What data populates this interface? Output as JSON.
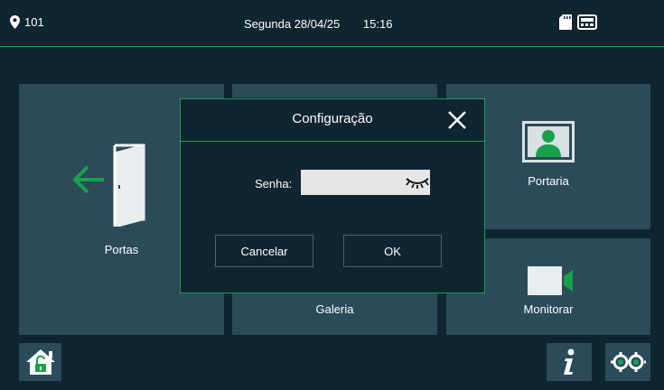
{
  "status_bar": {
    "location_icon": "location-pin-icon",
    "apartment": "101",
    "date": "Segunda 28/04/25",
    "time": "15:16",
    "icons": [
      "sd-card-icon",
      "intercom-device-icon"
    ]
  },
  "tiles": {
    "portas": "Portas",
    "portaria": "Portaria",
    "galeria": "Galeria",
    "monitorar": "Monitorar"
  },
  "bottom_bar": {
    "home_icon": "home-unlock-icon",
    "info_icon": "info-icon",
    "settings_icon": "settings-icon"
  },
  "dialog": {
    "title": "Configuração",
    "password_label": "Senha:",
    "password_value": "",
    "eye_icon": "eye-closed-icon",
    "cancel_label": "Cancelar",
    "ok_label": "OK"
  },
  "colors": {
    "accent": "#19a14a",
    "background": "#0f2530",
    "tile": "#2b4a5a"
  }
}
